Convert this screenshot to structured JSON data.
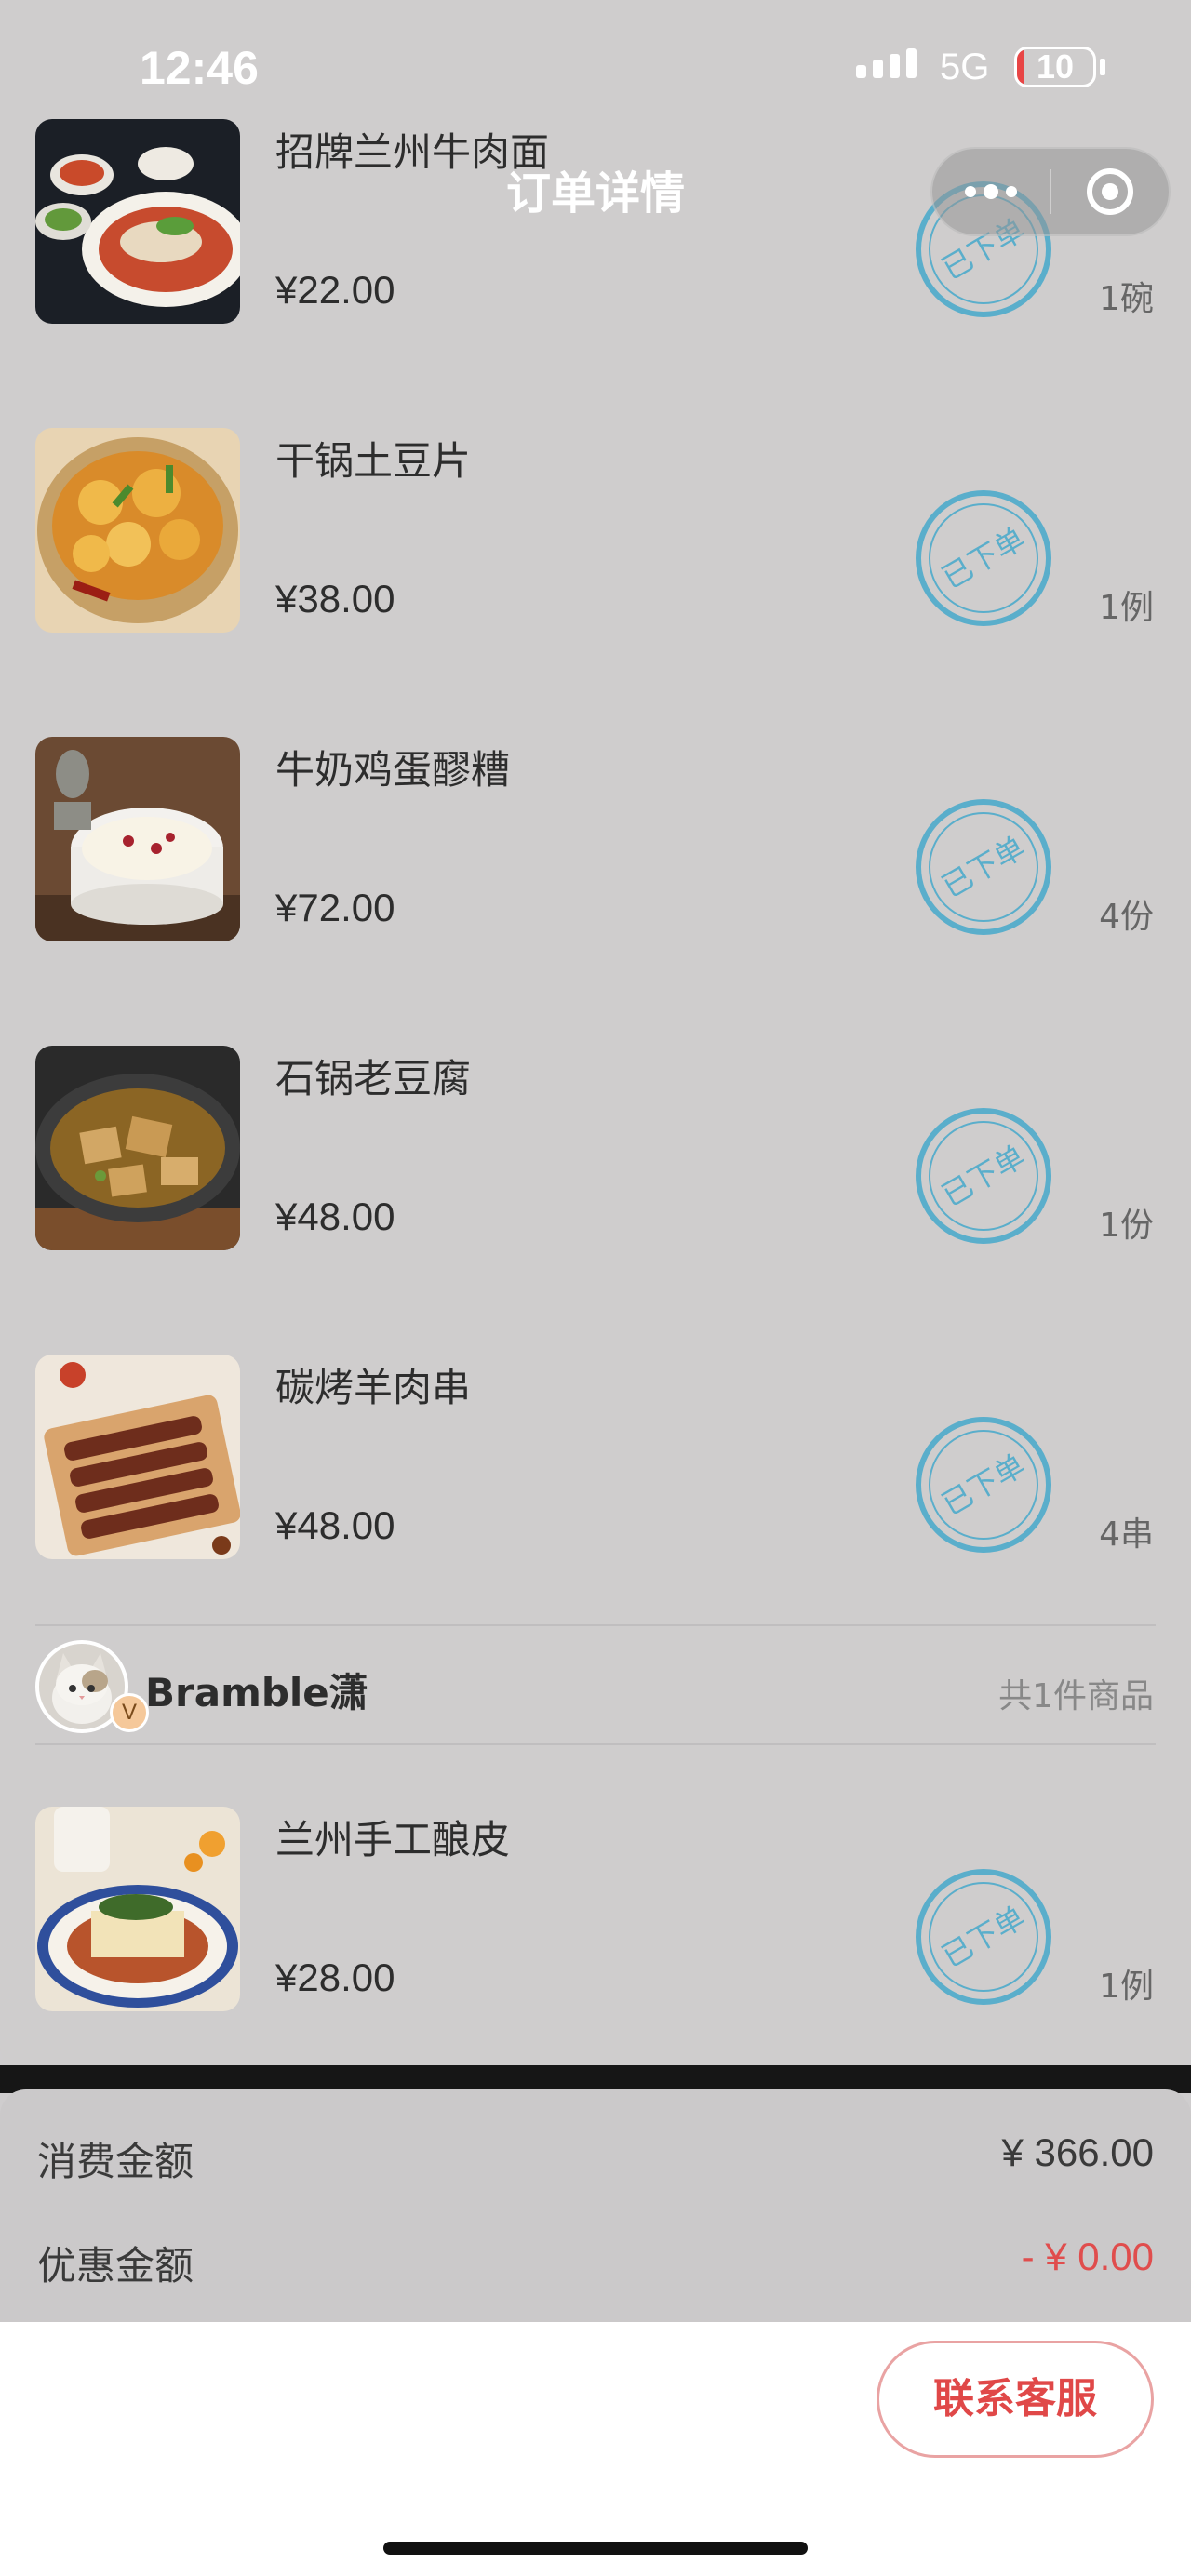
{
  "status_bar": {
    "time": "12:46",
    "network": "5G",
    "battery": "10",
    "battery_level": 0.1
  },
  "nav": {
    "title": "订单详情"
  },
  "items": [
    {
      "name": "招牌兰州牛肉面",
      "price": "¥22.00",
      "qty": "1碗",
      "stamp": "已下单",
      "image": "beef-noodle-soup"
    },
    {
      "name": "干锅土豆片",
      "price": "¥38.00",
      "qty": "1例",
      "stamp": "已下单",
      "image": "dry-pot-potato"
    },
    {
      "name": "牛奶鸡蛋醪糟",
      "price": "¥72.00",
      "qty": "4份",
      "stamp": "已下单",
      "image": "milk-egg-rice-wine"
    },
    {
      "name": "石锅老豆腐",
      "price": "¥48.00",
      "qty": "1份",
      "stamp": "已下单",
      "image": "stone-pot-tofu"
    },
    {
      "name": "碳烤羊肉串",
      "price": "¥48.00",
      "qty": "4串",
      "stamp": "已下单",
      "image": "lamb-skewers"
    }
  ],
  "user_group": {
    "name": "Bramble潇",
    "badge": "V",
    "count_label": "共1件商品"
  },
  "user_items": [
    {
      "name": "兰州手工酿皮",
      "price": "¥28.00",
      "qty": "1例",
      "stamp": "已下单",
      "image": "cold-noodle-skin"
    }
  ],
  "summary": {
    "total_label": "消费金额",
    "total_value": "¥ 366.00",
    "discount_label": "优惠金额",
    "discount_value": "- ¥ 0.00"
  },
  "actions": {
    "contact_label": "联系客服"
  },
  "colors": {
    "accent_red": "#e04848",
    "stamp_blue": "#5aaecb"
  }
}
